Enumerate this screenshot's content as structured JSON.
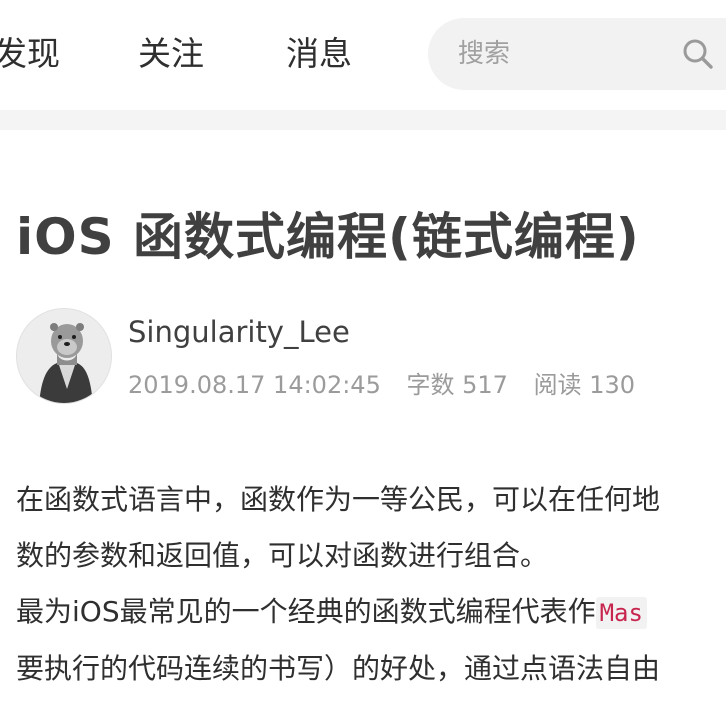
{
  "nav": {
    "items": [
      {
        "label": "发现"
      },
      {
        "label": "关注"
      },
      {
        "label": "消息"
      }
    ]
  },
  "search": {
    "placeholder": "搜索",
    "icon": "search-icon"
  },
  "article": {
    "title": "iOS 函数式编程(链式编程)",
    "author": {
      "name": "Singularity_Lee",
      "avatar_icon": "otter-avatar"
    },
    "meta": {
      "datetime": "2019.08.17 14:02:45",
      "word_count": "字数 517",
      "reads": "阅读 130"
    },
    "body": {
      "line1": "在函数式语言中，函数作为一等公民，可以在任何地",
      "line2": "数的参数和返回值，可以对函数进行组合。",
      "line3_text": "最为iOS最常见的一个经典的函数式编程代表作",
      "line3_code": "Mas",
      "line4": "要执行的代码连续的书写）的好处，通过点语法自由"
    }
  },
  "colors": {
    "text": "#2f2f2f",
    "meta": "#9b9b9b",
    "search_bg": "#f2f2f2",
    "code": "#c7254e"
  }
}
